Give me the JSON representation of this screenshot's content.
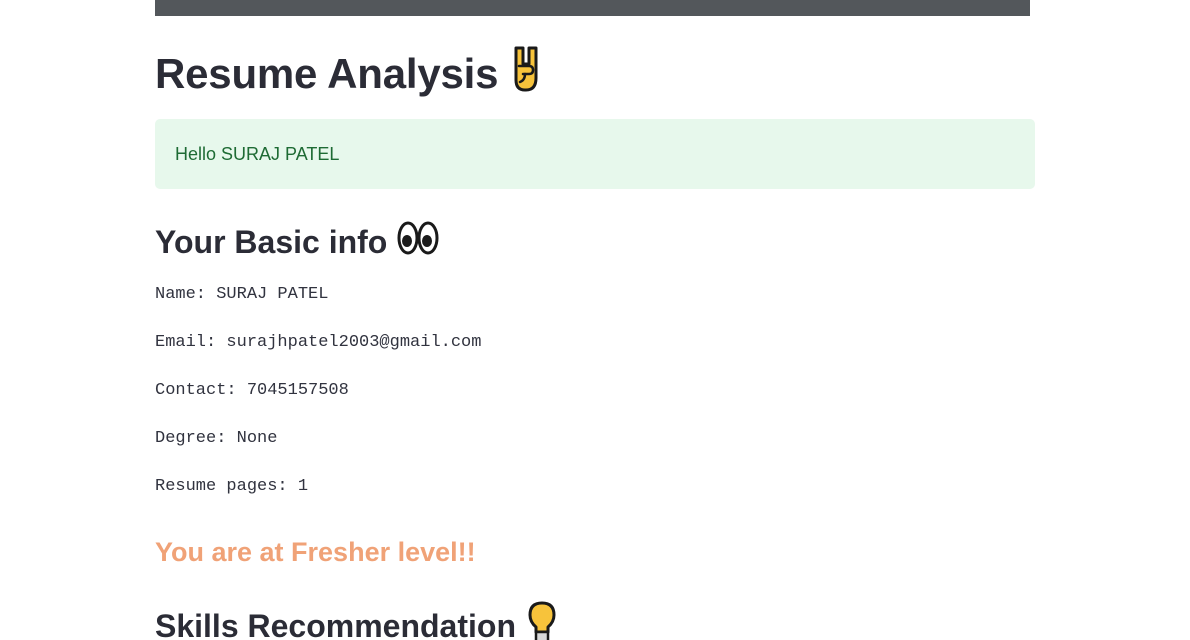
{
  "header": {
    "title": "Resume Analysis",
    "title_icon": "rock-hand-icon"
  },
  "greeting": "Hello SURAJ PATEL",
  "basic_info": {
    "heading": "Your Basic info",
    "heading_icon": "eyes-icon",
    "lines": [
      "Name: SURAJ PATEL",
      "Email: surajhpatel2003@gmail.com",
      "Contact: 7045157508",
      "Degree: None",
      "Resume pages: 1"
    ]
  },
  "level_text": "You are at Fresher level!!",
  "skills": {
    "heading": "Skills Recommendation",
    "heading_icon": "lightbulb-icon"
  },
  "colors": {
    "top_bar": "#53575b",
    "alert_bg": "#e7f8ec",
    "alert_text": "#1e6b34",
    "level_text": "#f0a277"
  }
}
